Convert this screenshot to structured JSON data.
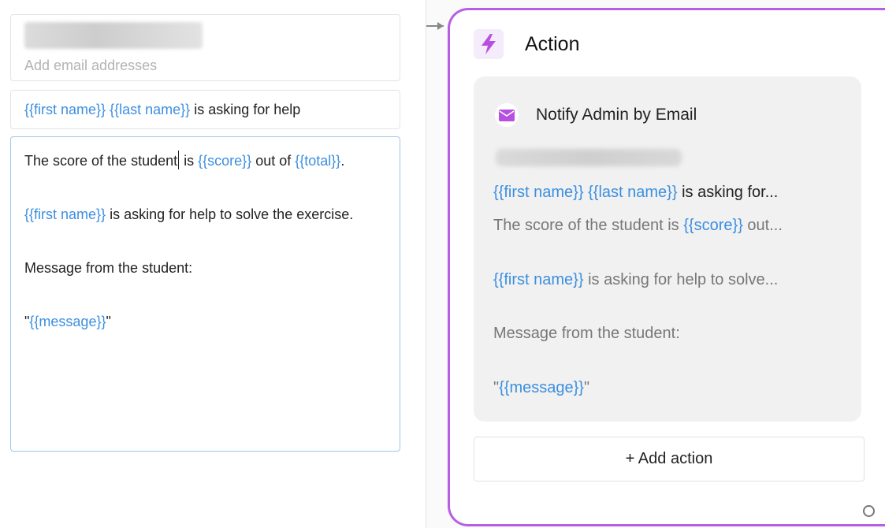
{
  "editor": {
    "email_placeholder": "Add email addresses",
    "subject": {
      "var1": "{{first name}}",
      "space": " ",
      "var2": "{{last name}}",
      "text": " is asking for help"
    },
    "body": {
      "p1_a": "The score of the student",
      "p1_b": " is ",
      "p1_var1": "{{score}}",
      "p1_c": " out of ",
      "p1_var2": "{{total}}",
      "p1_d": ".",
      "p2_var": "{{first name}}",
      "p2_text": " is asking for help to solve the exercise.",
      "p3_text": "Message from the student:",
      "p4_open": "\"",
      "p4_var": "{{message}}",
      "p4_close": "\""
    }
  },
  "action_node": {
    "title": "Action",
    "card": {
      "title": "Notify Admin by Email",
      "subject_var1": "{{first name}}",
      "subject_space": " ",
      "subject_var2": "{{last name}}",
      "subject_text": " is asking for...",
      "line1_text": "The score of the student is ",
      "line1_var": "{{score}}",
      "line1_end": " out...",
      "line2_var": "{{first name}}",
      "line2_text": " is asking for help to solve...",
      "line3_text": "Message from the student:",
      "line4_open": "\"",
      "line4_var": "{{message}}",
      "line4_close": "\""
    },
    "add_action_label": "+ Add action"
  },
  "colors": {
    "variable": "#3b8fe0",
    "node_border": "#b85ee3",
    "icon_accent": "#b74fe0"
  },
  "icons": {
    "action": "lightning-bolt-icon",
    "card": "envelope-icon"
  }
}
